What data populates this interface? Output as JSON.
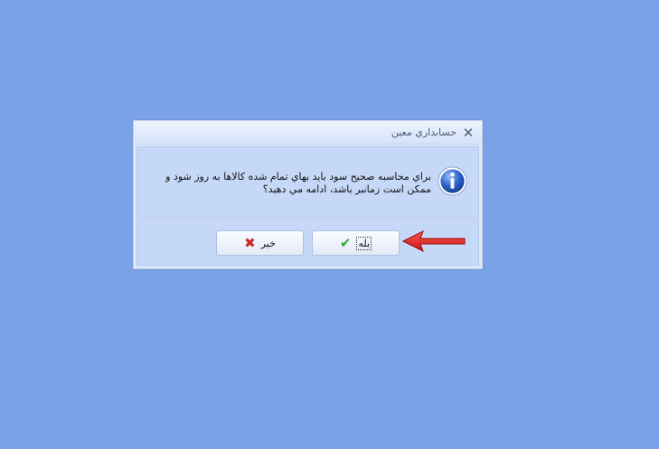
{
  "dialog": {
    "title": "حسابداري معين",
    "close_glyph": "✕",
    "message_line1": "براي محاسبه صحيح سود بايد بهاي تمام شده كالاها به روز شود و",
    "message_line2": "ممكن است زمانبر باشد، ادامه مي دهيد؟",
    "yes_label": "بله",
    "no_label": "خير",
    "yes_icon": "check-icon",
    "no_icon": "cross-icon",
    "info_icon": "info-icon"
  },
  "colors": {
    "background": "#7ba1e6",
    "accent_arrow": "#e02020",
    "check": "#3aa33a",
    "cross": "#c8282b"
  }
}
